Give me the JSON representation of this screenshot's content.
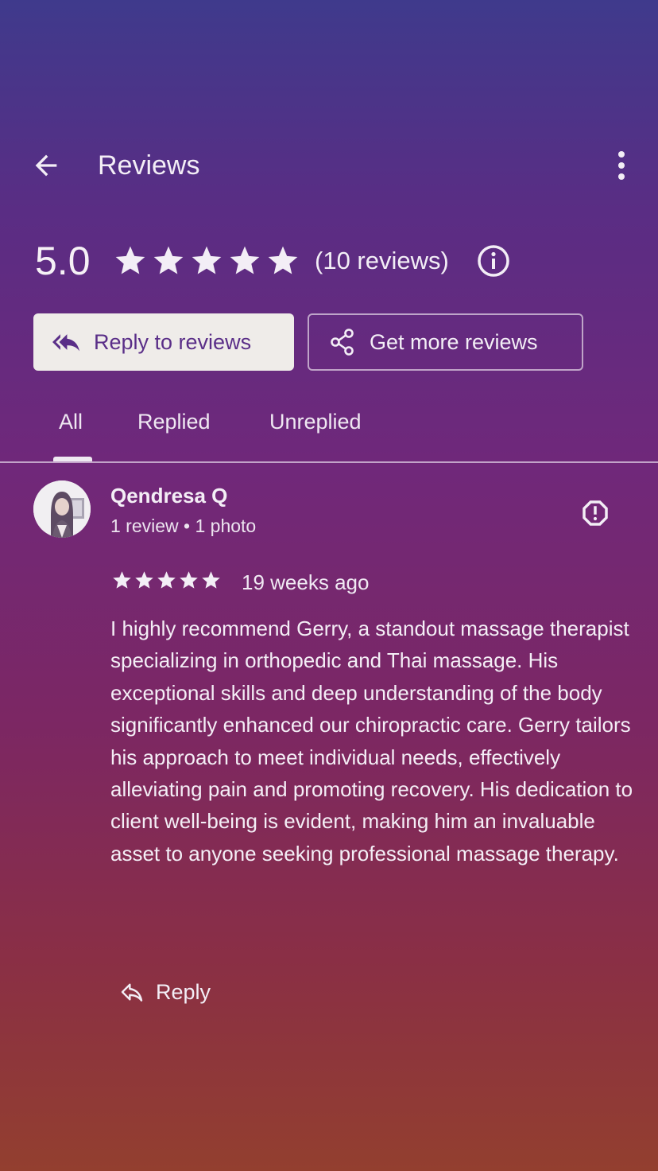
{
  "header": {
    "title": "Reviews",
    "back_icon": "arrow-back-icon",
    "more_icon": "more-vert-icon"
  },
  "rating": {
    "score": "5.0",
    "stars": 5,
    "count_label": "(10 reviews)",
    "info_icon": "info-icon"
  },
  "actions": {
    "reply_to_reviews": "Reply to reviews",
    "get_more_reviews": "Get more reviews"
  },
  "tabs": [
    {
      "label": "All",
      "selected": true
    },
    {
      "label": "Replied",
      "selected": false
    },
    {
      "label": "Unreplied",
      "selected": false
    }
  ],
  "review": {
    "reviewer_name": "Qendresa Q",
    "reviewer_meta": "1 review • 1 photo",
    "stars": 5,
    "time": "19 weeks ago",
    "text": "I highly recommend Gerry, a standout massage therapist specializing in orthopedic and Thai massage. His exceptional skills and deep understanding of the body significantly enhanced our chiropractic care. Gerry tailors his approach to meet individual needs, effectively alleviating pain and promoting recovery. His dedication to client well-being is evident, making him an invaluable asset to anyone seeking professional massage therapy.",
    "reply_label": "Reply"
  },
  "colors": {
    "gradient_top": "#3f3a8c",
    "gradient_bottom": "#933f2f",
    "button_fill": "#efece9",
    "button_text": "#5a2e88"
  }
}
